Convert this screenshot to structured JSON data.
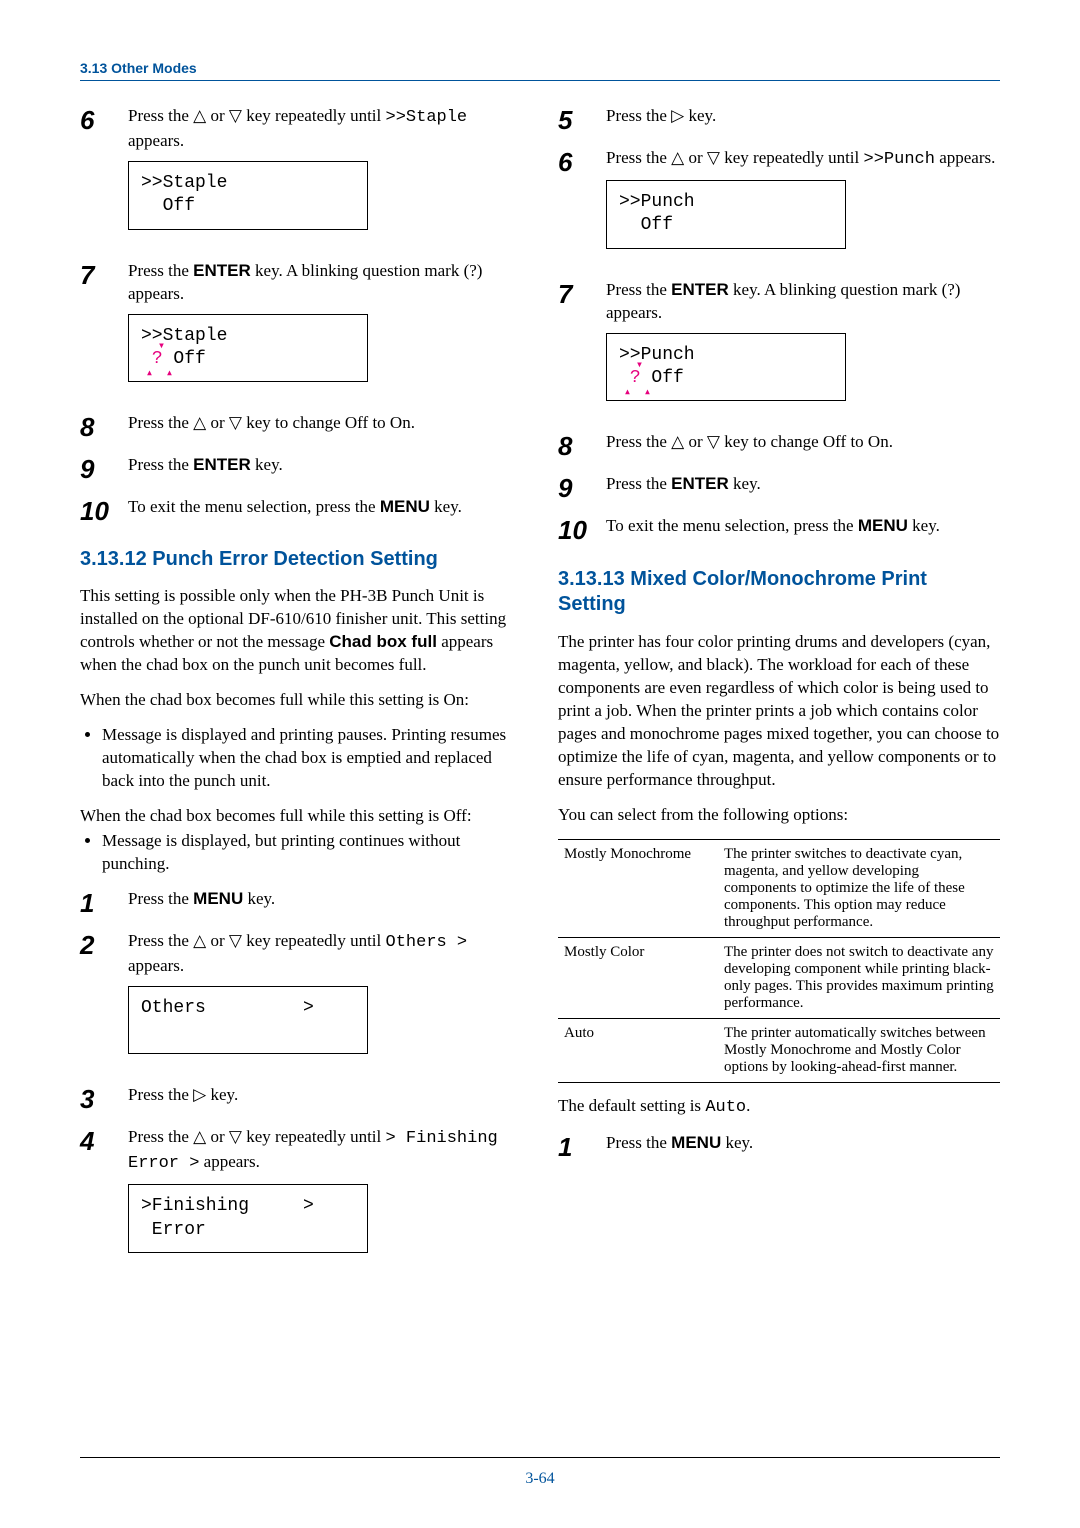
{
  "header": "3.13 Other Modes",
  "sym": {
    "up": "△",
    "down": "▽",
    "right": "▷"
  },
  "left": {
    "s6": {
      "text_a": "Press the ",
      "text_b": " or ",
      "text_c": " key repeatedly until ",
      "code": ">>Staple",
      "text_d": " appears.",
      "lcd1": ">>Staple",
      "lcd2": "  Off"
    },
    "s7": {
      "text_a": "Press the ",
      "key": "ENTER",
      "text_b": " key. A blinking question mark (?) appears.",
      "lcd1": ">>Staple",
      "lcd2_q": "?",
      "lcd2_rest": " Off"
    },
    "s8": {
      "text_a": "Press the ",
      "text_b": " or ",
      "text_c": " key to change Off to On."
    },
    "s9": {
      "text_a": "Press the ",
      "key": "ENTER",
      "text_b": " key."
    },
    "s10": {
      "text_a": "To exit the menu selection, press the ",
      "key": "MENU",
      "text_b": " key."
    },
    "h12": "3.13.12  Punch Error Detection Setting",
    "p1_a": "This setting is possible only when the PH-3B Punch Unit is installed on the optional DF-610/610 finisher unit. This setting controls whether or not the message ",
    "p1_bold": "Chad box full",
    "p1_b": " appears when the chad box on the punch unit becomes full.",
    "on_intro": "When the chad box becomes full while this setting is On:",
    "on_bullet": "Message is displayed and printing pauses. Printing resumes automatically when the chad box is emptied and replaced back into the punch unit.",
    "off_intro": "When the chad box becomes full while this setting is Off:",
    "off_bullet": "Message is displayed, but printing continues without punching.",
    "s1": {
      "text_a": "Press the ",
      "key": "MENU",
      "text_b": " key."
    },
    "s2": {
      "text_a": "Press the ",
      "text_b": " or ",
      "text_c": " key repeatedly until ",
      "code": "Others  >",
      "text_d": " appears.",
      "lcd1": "Others         >",
      "lcd2": " "
    },
    "s3": {
      "text_a": "Press the ",
      "text_b": " key."
    },
    "s4": {
      "text_a": "Press the ",
      "text_b": " or ",
      "text_c": " key repeatedly until ",
      "code1": "> Finishing Error >",
      "text_d": " appears.",
      "lcd1": ">Finishing     >",
      "lcd2": " Error"
    }
  },
  "right": {
    "s5": {
      "text_a": "Press the ",
      "text_b": " key."
    },
    "s6": {
      "text_a": "Press the ",
      "text_b": " or ",
      "text_c": " key repeatedly until ",
      "code": ">>Punch",
      "text_d": " appears.",
      "lcd1": ">>Punch",
      "lcd2": "  Off"
    },
    "s7": {
      "text_a": "Press the ",
      "key": "ENTER",
      "text_b": " key. A blinking question mark (?) appears.",
      "lcd1": ">>Punch",
      "lcd2_q": "?",
      "lcd2_rest": " Off"
    },
    "s8": {
      "text_a": "Press the ",
      "text_b": " or ",
      "text_c": " key to change Off to On."
    },
    "s9": {
      "text_a": "Press the ",
      "key": "ENTER",
      "text_b": " key."
    },
    "s10": {
      "text_a": "To exit the menu selection, press the ",
      "key": "MENU",
      "text_b": " key."
    },
    "h13": "3.13.13  Mixed Color/Monochrome Print Setting",
    "p1": "The printer has four color printing drums and developers (cyan, magenta, yellow, and black). The workload for each of these components are even regardless of which color is being used to print a job. When the printer prints a job which contains color pages and monochrome pages mixed together, you can choose to optimize the life of cyan, magenta, and yellow components or to ensure performance throughput.",
    "p2": "You can select from the following options:",
    "table": [
      {
        "k": "Mostly Monochrome",
        "v": "The printer switches to deactivate cyan, magenta, and yellow developing components to optimize the life of these components. This option may reduce throughput performance."
      },
      {
        "k": "Mostly Color",
        "v": "The printer does not switch to deactivate any developing component while printing black-only pages. This provides maximum printing performance."
      },
      {
        "k": "Auto",
        "v": "The printer automatically switches between Mostly Monochrome and Mostly Color options by looking-ahead-first manner."
      }
    ],
    "p3_a": "The default setting is ",
    "p3_code": "Auto",
    "p3_b": ".",
    "s1": {
      "text_a": "Press the ",
      "key": "MENU",
      "text_b": " key."
    }
  },
  "page": "3-64"
}
